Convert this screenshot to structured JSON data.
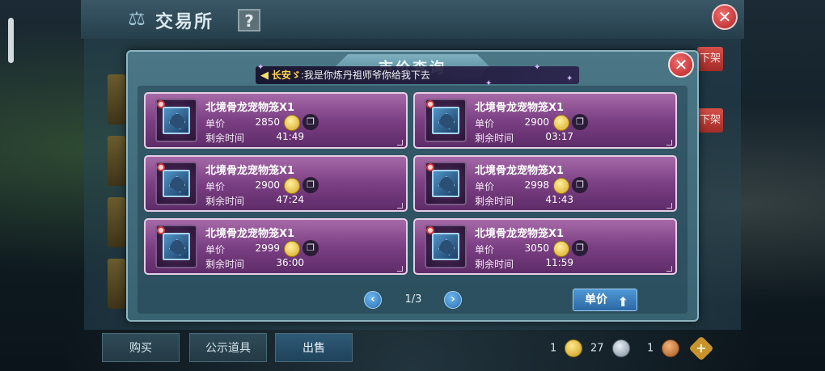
{
  "market": {
    "title": "交易所",
    "help_label": "?",
    "close_label": "✕",
    "delist_label": "下架",
    "tabs": [
      {
        "label": "购买"
      },
      {
        "label": "公示道具"
      },
      {
        "label": "出售",
        "active": true
      }
    ],
    "currency": [
      {
        "amount": "1",
        "type": "gold"
      },
      {
        "amount": "27",
        "type": "silver"
      },
      {
        "amount": "1",
        "type": "bronze"
      }
    ],
    "add_label": "+"
  },
  "modal": {
    "title": "市价查询",
    "close_label": "✕",
    "chat": {
      "sender": "长安ゞ",
      "message": ":我是你炼丹祖师爷你给我下去"
    },
    "labels": {
      "price": "单价",
      "time_left": "剩余时间"
    },
    "items": [
      {
        "name": "北境骨龙宠物笼X1",
        "price": "2850",
        "time_left": "41:49"
      },
      {
        "name": "北境骨龙宠物笼X1",
        "price": "2900",
        "time_left": "03:17"
      },
      {
        "name": "北境骨龙宠物笼X1",
        "price": "2900",
        "time_left": "47:24"
      },
      {
        "name": "北境骨龙宠物笼X1",
        "price": "2998",
        "time_left": "41:43"
      },
      {
        "name": "北境骨龙宠物笼X1",
        "price": "2999",
        "time_left": "36:00"
      },
      {
        "name": "北境骨龙宠物笼X1",
        "price": "3050",
        "time_left": "11:59"
      }
    ],
    "pagination": {
      "prev_label": "‹",
      "next_label": "›",
      "indicator": "1/3"
    },
    "sort_button": {
      "label": "单价",
      "icon": "up-arrow-icon"
    }
  },
  "colors": {
    "card_purple": "#7b3f84",
    "modal_teal": "#4a7686",
    "close_red": "#b82424",
    "coin_gold": "#d6a51f"
  }
}
